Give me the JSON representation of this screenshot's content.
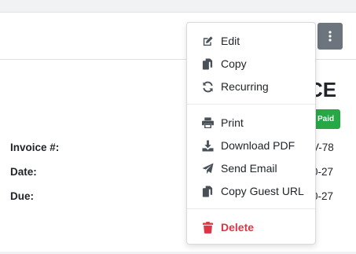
{
  "header": {
    "more_actions_icon": "vertical-ellipsis-icon"
  },
  "invoice": {
    "title_visible": "CE",
    "status": "Paid",
    "status_color": "#28a745",
    "fields": [
      {
        "label": "Invoice #:",
        "value_visible": "V-78"
      },
      {
        "label": "Date:",
        "value_visible": "0-27"
      },
      {
        "label": "Due:",
        "value_visible": "0-27"
      }
    ]
  },
  "menu": {
    "groups": [
      [
        {
          "label": "Edit",
          "icon": "edit-icon"
        },
        {
          "label": "Copy",
          "icon": "copy-icon"
        },
        {
          "label": "Recurring",
          "icon": "sync-icon"
        }
      ],
      [
        {
          "label": "Print",
          "icon": "print-icon"
        },
        {
          "label": "Download PDF",
          "icon": "download-icon"
        },
        {
          "label": "Send Email",
          "icon": "paper-plane-icon"
        },
        {
          "label": "Copy Guest URL",
          "icon": "copy-icon"
        }
      ],
      [
        {
          "label": "Delete",
          "icon": "trash-icon",
          "danger": true
        }
      ]
    ]
  },
  "colors": {
    "icon_gray": "#495057",
    "danger": "#dc3545",
    "kebab_bg": "#6c757d"
  }
}
